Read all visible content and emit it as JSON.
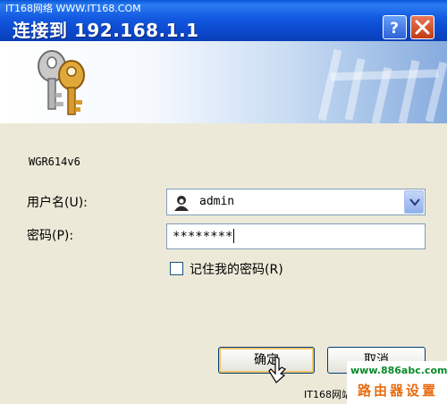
{
  "window": {
    "title": "连接到 192.168.1.1",
    "watermark_top": "IT168网络 WWW.IT168.COM",
    "help_label": "?",
    "close_label": "×"
  },
  "body": {
    "device_name": "WGR614v6",
    "username_label": "用户名(U):",
    "password_label": "密码(P):",
    "username_value": "admin",
    "password_value": "********",
    "remember_label": "记住我的密码(R)",
    "remember_checked": false
  },
  "buttons": {
    "ok_label": "确定",
    "cancel_label": "取消"
  },
  "overlays": {
    "watermark_bottom": "IT168网站",
    "site_url": "www.886abc.com",
    "site_name": "路由器设置"
  },
  "colors": {
    "title_bar": "#0b47c9",
    "dialog_bg": "#ece9d8",
    "site_url": "#0a8a2a",
    "site_name": "#e86b10"
  },
  "icons": [
    "keys-icon",
    "help-icon",
    "close-icon",
    "user-icon",
    "dropdown-arrow-icon",
    "mouse-cursor-icon"
  ]
}
